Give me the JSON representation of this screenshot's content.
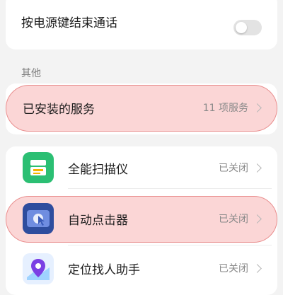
{
  "top_card": {
    "setting_label": "按电源键结束通话",
    "toggle_state": "off"
  },
  "section_other": {
    "title": "其他",
    "installed_services": {
      "label": "已安装的服务",
      "value": "11 项服务"
    }
  },
  "services": {
    "items": [
      {
        "label": "全能扫描仪",
        "status": "已关闭",
        "icon": "scanner-icon"
      },
      {
        "label": "自动点击器",
        "status": "已关闭",
        "icon": "auto-clicker-icon"
      },
      {
        "label": "定位找人助手",
        "status": "已关闭",
        "icon": "location-pin-icon"
      }
    ]
  },
  "colors": {
    "highlight": "#f9c6c6",
    "highlight_border": "#e98e8e",
    "scanner_green": "#2bbf73",
    "clicker_blue": "#2e4d9e",
    "location_purple": "#7b3fe4"
  }
}
